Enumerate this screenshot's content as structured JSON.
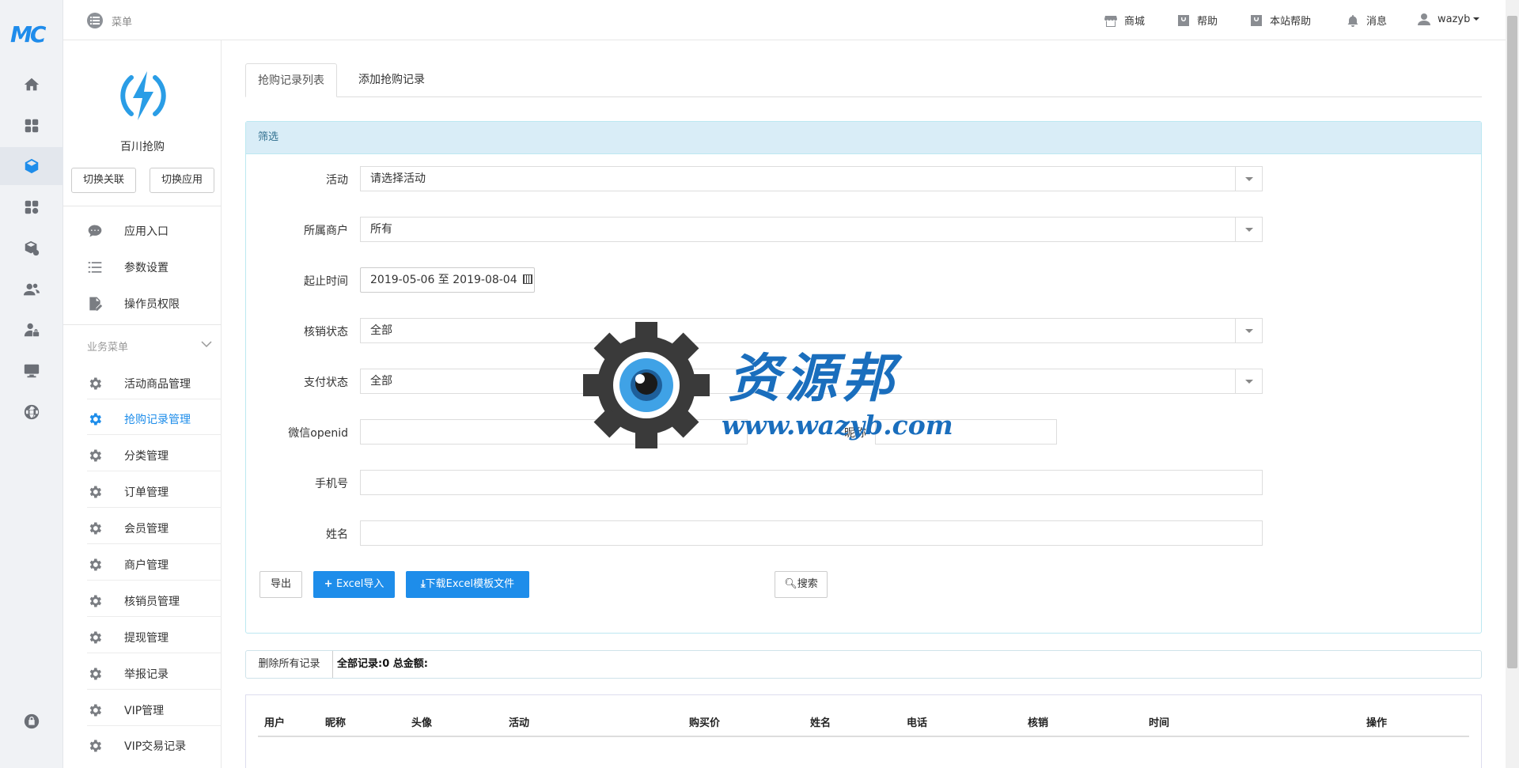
{
  "brand": {
    "logo_text": "MC"
  },
  "topbar": {
    "menu_label": "菜单",
    "links": [
      {
        "label": "商城",
        "icon": "store-icon"
      },
      {
        "label": "帮助",
        "icon": "help-bag-icon"
      },
      {
        "label": "本站帮助",
        "icon": "site-help-icon"
      },
      {
        "label": "消息",
        "icon": "bell-icon"
      }
    ],
    "user": "wazyb"
  },
  "app": {
    "name": "百川抢购",
    "switch_link": "切换关联",
    "switch_app": "切换应用"
  },
  "sidebar": {
    "top_items": [
      {
        "label": "应用入口",
        "icon": "chat-icon"
      },
      {
        "label": "参数设置",
        "icon": "list-icon"
      },
      {
        "label": "操作员权限",
        "icon": "edit-doc-icon"
      }
    ],
    "section_title": "业务菜单",
    "items": [
      {
        "label": "活动商品管理",
        "active": false
      },
      {
        "label": "抢购记录管理",
        "active": true
      },
      {
        "label": "分类管理",
        "active": false
      },
      {
        "label": "订单管理",
        "active": false
      },
      {
        "label": "会员管理",
        "active": false
      },
      {
        "label": "商户管理",
        "active": false
      },
      {
        "label": "核销员管理",
        "active": false
      },
      {
        "label": "提现管理",
        "active": false
      },
      {
        "label": "举报记录",
        "active": false
      },
      {
        "label": "VIP管理",
        "active": false
      },
      {
        "label": "VIP交易记录",
        "active": false
      }
    ]
  },
  "tabs": [
    {
      "label": "抢购记录列表",
      "active": true
    },
    {
      "label": "添加抢购记录",
      "active": false
    }
  ],
  "filter": {
    "title": "筛选",
    "activity": {
      "label": "活动",
      "value": "请选择活动"
    },
    "merchant": {
      "label": "所属商户",
      "value": "所有"
    },
    "date": {
      "label": "起止时间",
      "value": "2019-05-06 至 2019-08-04"
    },
    "verify_status": {
      "label": "核销状态",
      "value": "全部"
    },
    "pay_status": {
      "label": "支付状态",
      "value": "全部"
    },
    "openid": {
      "label": "微信openid",
      "value": ""
    },
    "nickname": {
      "label": "昵称",
      "value": ""
    },
    "phone": {
      "label": "手机号",
      "value": ""
    },
    "name": {
      "label": "姓名",
      "value": ""
    }
  },
  "actions": {
    "export": "导出",
    "excel_import": "Excel导入",
    "download_template": "下载Excel模板文件",
    "search": "搜索"
  },
  "summary": {
    "delete_all": "删除所有记录",
    "text": "全部记录:0 总金额:"
  },
  "table": {
    "columns": [
      "用户",
      "昵称",
      "头像",
      "活动",
      "购买价",
      "姓名",
      "电话",
      "核销",
      "时间",
      "操作"
    ]
  },
  "watermark": {
    "title": "资源邦",
    "url": "www.wazyb.com"
  },
  "colors": {
    "primary": "#1e8dea",
    "panel_head": "#d9edf7",
    "panel_border": "#bce8f1"
  }
}
